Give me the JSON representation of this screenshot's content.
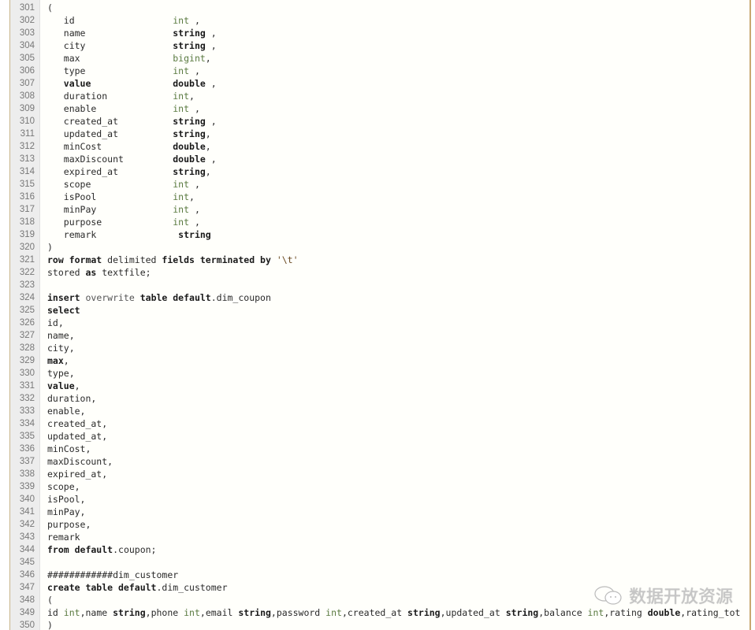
{
  "editor": {
    "lines": [
      {
        "n": "301",
        "tokens": [
          {
            "t": "(",
            "c": "plain"
          }
        ]
      },
      {
        "n": "302",
        "tokens": [
          {
            "t": "   id                  ",
            "c": "plain"
          },
          {
            "t": "int",
            "c": "int"
          },
          {
            "t": " ,",
            "c": "plain"
          }
        ]
      },
      {
        "n": "303",
        "tokens": [
          {
            "t": "   name                ",
            "c": "plain"
          },
          {
            "t": "string",
            "c": "kw"
          },
          {
            "t": " ,",
            "c": "plain"
          }
        ]
      },
      {
        "n": "304",
        "tokens": [
          {
            "t": "   city                ",
            "c": "plain"
          },
          {
            "t": "string",
            "c": "kw"
          },
          {
            "t": " ,",
            "c": "plain"
          }
        ]
      },
      {
        "n": "305",
        "tokens": [
          {
            "t": "   max                 ",
            "c": "plain"
          },
          {
            "t": "bigint",
            "c": "int"
          },
          {
            "t": ",",
            "c": "plain"
          }
        ]
      },
      {
        "n": "306",
        "tokens": [
          {
            "t": "   type                ",
            "c": "plain"
          },
          {
            "t": "int",
            "c": "int"
          },
          {
            "t": " ,",
            "c": "plain"
          }
        ]
      },
      {
        "n": "307",
        "tokens": [
          {
            "t": "   value               ",
            "c": "kw"
          },
          {
            "t": "double",
            "c": "kw"
          },
          {
            "t": " ,",
            "c": "plain"
          }
        ]
      },
      {
        "n": "308",
        "tokens": [
          {
            "t": "   duration            ",
            "c": "plain"
          },
          {
            "t": "int",
            "c": "int"
          },
          {
            "t": ",",
            "c": "plain"
          }
        ]
      },
      {
        "n": "309",
        "tokens": [
          {
            "t": "   enable              ",
            "c": "plain"
          },
          {
            "t": "int",
            "c": "int"
          },
          {
            "t": " ,",
            "c": "plain"
          }
        ]
      },
      {
        "n": "310",
        "tokens": [
          {
            "t": "   created_at          ",
            "c": "plain"
          },
          {
            "t": "string",
            "c": "kw"
          },
          {
            "t": " ,",
            "c": "plain"
          }
        ]
      },
      {
        "n": "311",
        "tokens": [
          {
            "t": "   updated_at          ",
            "c": "plain"
          },
          {
            "t": "string",
            "c": "kw"
          },
          {
            "t": ",",
            "c": "plain"
          }
        ]
      },
      {
        "n": "312",
        "tokens": [
          {
            "t": "   minCost             ",
            "c": "plain"
          },
          {
            "t": "double",
            "c": "kw"
          },
          {
            "t": ",",
            "c": "plain"
          }
        ]
      },
      {
        "n": "313",
        "tokens": [
          {
            "t": "   maxDiscount         ",
            "c": "plain"
          },
          {
            "t": "double",
            "c": "kw"
          },
          {
            "t": " ,",
            "c": "plain"
          }
        ]
      },
      {
        "n": "314",
        "tokens": [
          {
            "t": "   expired_at          ",
            "c": "plain"
          },
          {
            "t": "string",
            "c": "kw"
          },
          {
            "t": ",",
            "c": "plain"
          }
        ]
      },
      {
        "n": "315",
        "tokens": [
          {
            "t": "   scope               ",
            "c": "plain"
          },
          {
            "t": "int",
            "c": "int"
          },
          {
            "t": " ,",
            "c": "plain"
          }
        ]
      },
      {
        "n": "316",
        "tokens": [
          {
            "t": "   isPool              ",
            "c": "plain"
          },
          {
            "t": "int",
            "c": "int"
          },
          {
            "t": ",",
            "c": "plain"
          }
        ]
      },
      {
        "n": "317",
        "tokens": [
          {
            "t": "   minPay              ",
            "c": "plain"
          },
          {
            "t": "int",
            "c": "int"
          },
          {
            "t": " ,",
            "c": "plain"
          }
        ]
      },
      {
        "n": "318",
        "tokens": [
          {
            "t": "   purpose             ",
            "c": "plain"
          },
          {
            "t": "int",
            "c": "int"
          },
          {
            "t": " ,",
            "c": "plain"
          }
        ]
      },
      {
        "n": "319",
        "tokens": [
          {
            "t": "   remark               ",
            "c": "plain"
          },
          {
            "t": "string",
            "c": "kw"
          }
        ]
      },
      {
        "n": "320",
        "tokens": [
          {
            "t": ")",
            "c": "plain"
          }
        ]
      },
      {
        "n": "321",
        "tokens": [
          {
            "t": "row format ",
            "c": "kw"
          },
          {
            "t": "delimited ",
            "c": "plain"
          },
          {
            "t": "fields terminated by ",
            "c": "kw"
          },
          {
            "t": "'\\t'",
            "c": "str"
          }
        ]
      },
      {
        "n": "322",
        "tokens": [
          {
            "t": "stored ",
            "c": "plain"
          },
          {
            "t": "as ",
            "c": "kw"
          },
          {
            "t": "textfile;",
            "c": "plain"
          }
        ]
      },
      {
        "n": "323",
        "tokens": []
      },
      {
        "n": "324",
        "tokens": [
          {
            "t": "insert ",
            "c": "kw"
          },
          {
            "t": "overwrite ",
            "c": "soft"
          },
          {
            "t": "table default",
            "c": "kw"
          },
          {
            "t": ".dim_coupon",
            "c": "plain"
          }
        ]
      },
      {
        "n": "325",
        "tokens": [
          {
            "t": "select",
            "c": "kw"
          }
        ]
      },
      {
        "n": "326",
        "tokens": [
          {
            "t": "id,",
            "c": "plain"
          }
        ]
      },
      {
        "n": "327",
        "tokens": [
          {
            "t": "name,",
            "c": "plain"
          }
        ]
      },
      {
        "n": "328",
        "tokens": [
          {
            "t": "city,",
            "c": "plain"
          }
        ]
      },
      {
        "n": "329",
        "tokens": [
          {
            "t": "max",
            "c": "kw"
          },
          {
            "t": ",",
            "c": "plain"
          }
        ]
      },
      {
        "n": "330",
        "tokens": [
          {
            "t": "type,",
            "c": "plain"
          }
        ]
      },
      {
        "n": "331",
        "tokens": [
          {
            "t": "value",
            "c": "kw"
          },
          {
            "t": ",",
            "c": "plain"
          }
        ]
      },
      {
        "n": "332",
        "tokens": [
          {
            "t": "duration,",
            "c": "plain"
          }
        ]
      },
      {
        "n": "333",
        "tokens": [
          {
            "t": "enable,",
            "c": "plain"
          }
        ]
      },
      {
        "n": "334",
        "tokens": [
          {
            "t": "created_at,",
            "c": "plain"
          }
        ]
      },
      {
        "n": "335",
        "tokens": [
          {
            "t": "updated_at,",
            "c": "plain"
          }
        ]
      },
      {
        "n": "336",
        "tokens": [
          {
            "t": "minCost,",
            "c": "plain"
          }
        ]
      },
      {
        "n": "337",
        "tokens": [
          {
            "t": "maxDiscount,",
            "c": "plain"
          }
        ]
      },
      {
        "n": "338",
        "tokens": [
          {
            "t": "expired_at,",
            "c": "plain"
          }
        ]
      },
      {
        "n": "339",
        "tokens": [
          {
            "t": "scope,",
            "c": "plain"
          }
        ]
      },
      {
        "n": "340",
        "tokens": [
          {
            "t": "isPool,",
            "c": "plain"
          }
        ]
      },
      {
        "n": "341",
        "tokens": [
          {
            "t": "minPay,",
            "c": "plain"
          }
        ]
      },
      {
        "n": "342",
        "tokens": [
          {
            "t": "purpose,",
            "c": "plain"
          }
        ]
      },
      {
        "n": "343",
        "tokens": [
          {
            "t": "remark",
            "c": "plain"
          }
        ]
      },
      {
        "n": "344",
        "tokens": [
          {
            "t": "from default",
            "c": "kw"
          },
          {
            "t": ".coupon;",
            "c": "plain"
          }
        ]
      },
      {
        "n": "345",
        "tokens": []
      },
      {
        "n": "346",
        "tokens": [
          {
            "t": "############dim_customer",
            "c": "plain"
          }
        ]
      },
      {
        "n": "347",
        "tokens": [
          {
            "t": "create table default",
            "c": "kw"
          },
          {
            "t": ".dim_customer",
            "c": "plain"
          }
        ]
      },
      {
        "n": "348",
        "tokens": [
          {
            "t": "(",
            "c": "plain"
          }
        ]
      },
      {
        "n": "349",
        "tokens": [
          {
            "t": "id ",
            "c": "plain"
          },
          {
            "t": "int",
            "c": "int"
          },
          {
            "t": ",name ",
            "c": "plain"
          },
          {
            "t": "string",
            "c": "kw"
          },
          {
            "t": ",phone ",
            "c": "plain"
          },
          {
            "t": "int",
            "c": "int"
          },
          {
            "t": ",email ",
            "c": "plain"
          },
          {
            "t": "string",
            "c": "kw"
          },
          {
            "t": ",password ",
            "c": "plain"
          },
          {
            "t": "int",
            "c": "int"
          },
          {
            "t": ",created_at ",
            "c": "plain"
          },
          {
            "t": "string",
            "c": "kw"
          },
          {
            "t": ",updated_at ",
            "c": "plain"
          },
          {
            "t": "string",
            "c": "kw"
          },
          {
            "t": ",balance ",
            "c": "plain"
          },
          {
            "t": "int",
            "c": "int"
          },
          {
            "t": ",rating ",
            "c": "plain"
          },
          {
            "t": "double",
            "c": "kw"
          },
          {
            "t": ",rating_tot",
            "c": "plain"
          }
        ]
      },
      {
        "n": "350",
        "tokens": [
          {
            "t": ")",
            "c": "plain"
          }
        ]
      }
    ]
  },
  "watermark": {
    "text": "数据开放资源",
    "icon": "wechat-icon"
  },
  "colors": {
    "type_int": "#5a7a40",
    "keyword": "#1a1a1a",
    "gutter_bg": "#ededed",
    "border": "#c8a870"
  }
}
